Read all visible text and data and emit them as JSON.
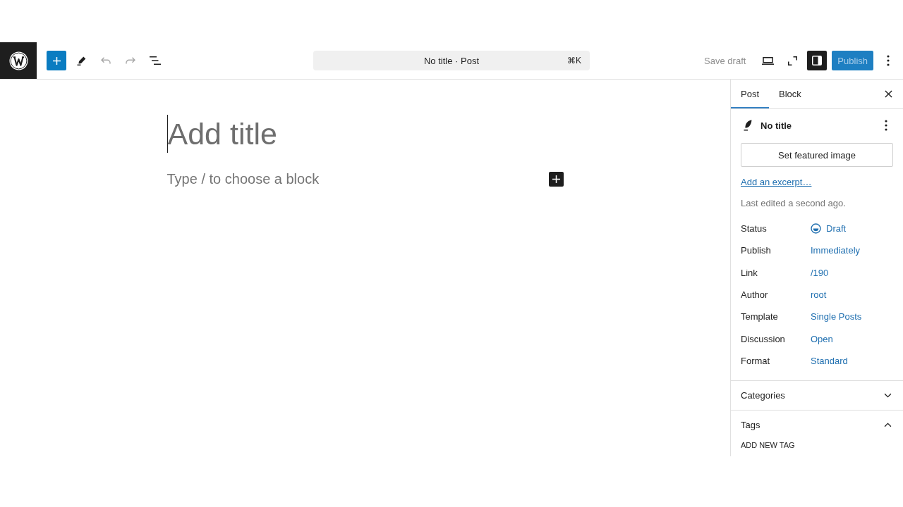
{
  "header": {
    "tools": [
      {
        "kind": "inserter",
        "disabled": false
      },
      {
        "kind": "tools",
        "disabled": false
      },
      {
        "kind": "undo",
        "disabled": true
      },
      {
        "kind": "redo",
        "disabled": true
      },
      {
        "kind": "list_view",
        "disabled": false
      }
    ],
    "command_bar": {
      "title": "No title · Post",
      "shortcut": "⌘K"
    },
    "save_draft": {
      "label": "Save draft",
      "disabled": true
    },
    "view_tools": [
      {
        "kind": "preview",
        "selected": false
      },
      {
        "kind": "zoom_out",
        "selected": false
      },
      {
        "kind": "settings",
        "selected": true
      }
    ],
    "publish": {
      "label": "Publish",
      "disabled": true
    }
  },
  "editor": {
    "title": {
      "placeholder": "Add title"
    },
    "block": {
      "placeholder": "Type / to choose a block"
    }
  },
  "sidebar": {
    "tabs": [
      {
        "label": "Post",
        "selected": true
      },
      {
        "label": "Block",
        "selected": false
      }
    ],
    "post_title": "No title",
    "featured_image_button": "Set featured image",
    "excerpt_link": "Add an excerpt…",
    "last_edited": "Last edited a second ago.",
    "rows": [
      {
        "kind": "status",
        "label": "Status",
        "value": "Draft"
      },
      {
        "kind": "link",
        "label": "Publish",
        "value": "Immediately"
      },
      {
        "kind": "link",
        "label": "Link",
        "value": "/190"
      },
      {
        "kind": "link",
        "label": "Author",
        "value": "root"
      },
      {
        "kind": "link",
        "label": "Template",
        "value": "Single Posts"
      },
      {
        "kind": "link",
        "label": "Discussion",
        "value": "Open"
      },
      {
        "kind": "link",
        "label": "Format",
        "value": "Standard"
      }
    ],
    "panels": [
      {
        "title": "Categories",
        "expanded": false
      },
      {
        "title": "Tags",
        "expanded": true,
        "field_label": "ADD NEW TAG"
      }
    ]
  }
}
